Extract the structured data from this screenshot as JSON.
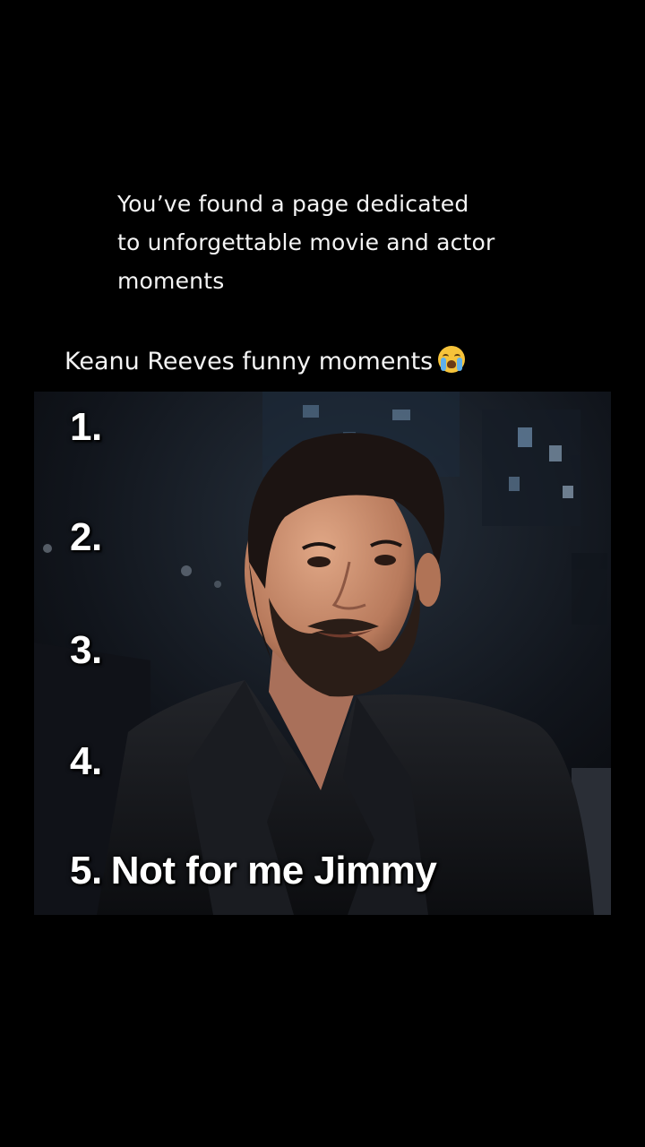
{
  "intro": {
    "line1": "You’ve found a page dedicated",
    "line2": "to unforgettable movie and actor",
    "line3": "moments"
  },
  "video": {
    "title": "Keanu Reeves funny moments",
    "title_emoji": "loudly-crying-face-emoji",
    "list": [
      {
        "number": "1.",
        "caption": ""
      },
      {
        "number": "2.",
        "caption": ""
      },
      {
        "number": "3.",
        "caption": ""
      },
      {
        "number": "4.",
        "caption": ""
      },
      {
        "number": "5.",
        "caption": "Not for me Jimmy"
      }
    ]
  },
  "colors": {
    "background": "#000000",
    "text": "#f4f4f4",
    "overlay_text": "#ffffff"
  }
}
